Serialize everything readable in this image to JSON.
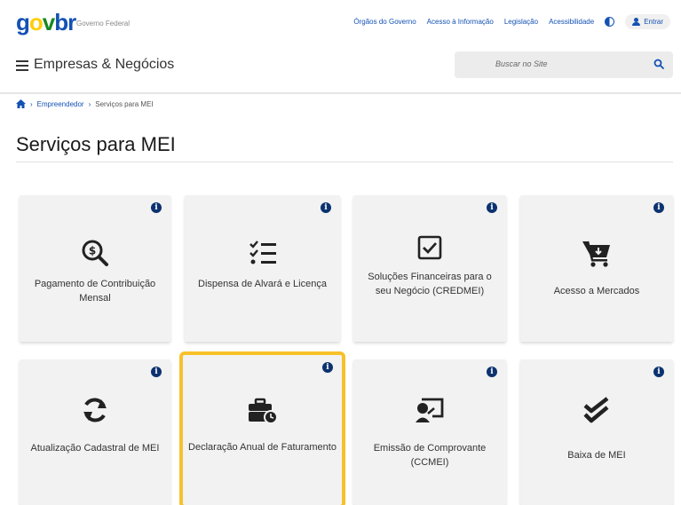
{
  "header": {
    "logo": {
      "g": "g",
      "o": "o",
      "v": "v",
      "b": "br"
    },
    "logo_subtitle": "Governo Federal",
    "links": [
      "Órgãos do Governo",
      "Acesso à Informação",
      "Legislação",
      "Acessibilidade"
    ],
    "login_label": "Entrar",
    "site_title": "Empresas & Negócios",
    "search_placeholder": "Buscar no Site"
  },
  "breadcrumb": {
    "items": [
      "Empreendedor",
      "Serviços para MEI"
    ]
  },
  "page": {
    "title": "Serviços para MEI"
  },
  "cards": [
    {
      "label": "Pagamento de Contribuição Mensal",
      "icon": "search-dollar-icon",
      "info": "i"
    },
    {
      "label": "Dispensa de Alvará e Licença",
      "icon": "checklist-icon",
      "info": "i"
    },
    {
      "label": "Soluções Financeiras para o seu Negócio (CREDMEI)",
      "icon": "checkbox-icon",
      "info": "i"
    },
    {
      "label": "Acesso a Mercados",
      "icon": "cart-icon",
      "info": "i"
    },
    {
      "label": "Atualização Cadastral de MEI",
      "icon": "sync-icon",
      "info": "i"
    },
    {
      "label": "Declaração Anual de Faturamento",
      "icon": "briefcase-clock-icon",
      "info": "i"
    },
    {
      "label": "Emissão de Comprovante (CCMEI)",
      "icon": "certificate-icon",
      "info": "i"
    },
    {
      "label": "Baixa de MEI",
      "icon": "double-check-icon",
      "info": "i"
    }
  ],
  "colors": {
    "primary": "#1351b4",
    "dark_blue": "#0c326f",
    "highlight": "#f7c12a",
    "card_bg": "#f2f2f2"
  }
}
